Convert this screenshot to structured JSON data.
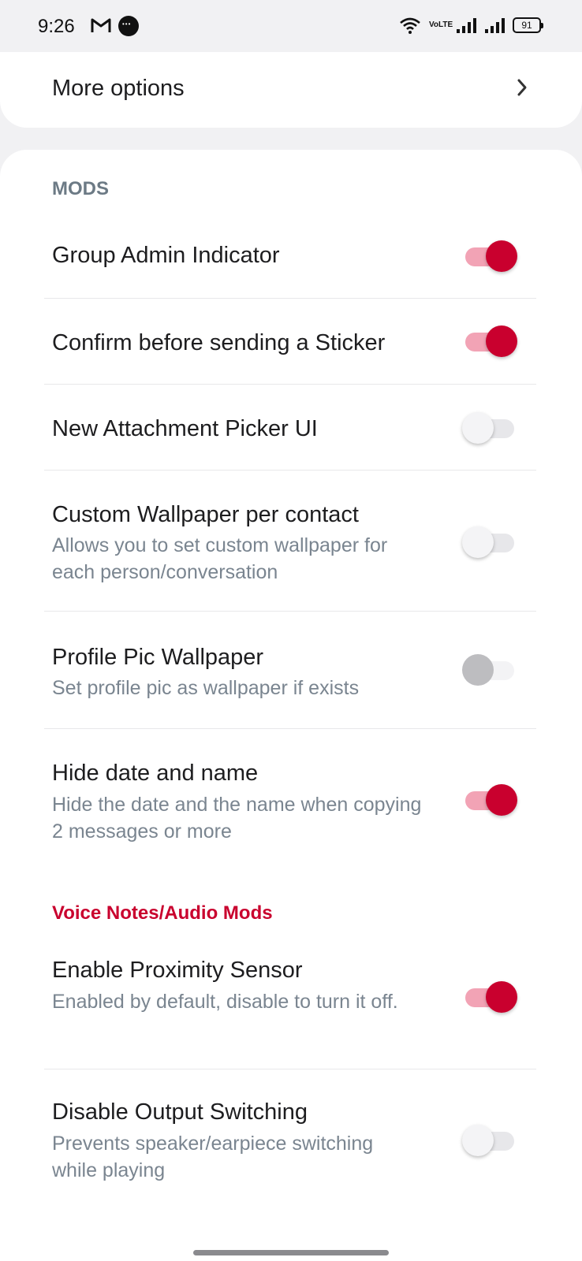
{
  "status_bar": {
    "time": "9:26",
    "network": "VoLTE",
    "battery": "91"
  },
  "more_options": {
    "label": "More options"
  },
  "mods_section": {
    "title": "MODS",
    "color": "#6c7a85"
  },
  "items": [
    {
      "title": "Group Admin Indicator",
      "subtitle": "",
      "state": "on"
    },
    {
      "title": "Confirm before sending a Sticker",
      "subtitle": "",
      "state": "on"
    },
    {
      "title": "New Attachment Picker UI",
      "subtitle": "",
      "state": "off"
    },
    {
      "title": "Custom Wallpaper per contact",
      "subtitle": "Allows you to set custom wallpaper for each person/conversation",
      "state": "off"
    },
    {
      "title": "Profile Pic Wallpaper",
      "subtitle": "Set profile pic as wallpaper if exists",
      "state": "disabled"
    },
    {
      "title": "Hide date and name",
      "subtitle": "Hide the date and the name when copying 2 messages or more",
      "state": "on"
    }
  ],
  "voice_section": {
    "title": "Voice Notes/Audio Mods",
    "color": "#c9002e"
  },
  "voice_items": [
    {
      "title": "Enable Proximity Sensor",
      "subtitle": "Enabled by default, disable to turn it off.",
      "state": "on"
    },
    {
      "title": "Disable Output Switching",
      "subtitle": "Prevents speaker/earpiece switching while playing",
      "state": "off"
    }
  ],
  "colors": {
    "accent": "#c9002e",
    "accent_track": "#f2a3b5",
    "background": "#f1f1f3"
  }
}
